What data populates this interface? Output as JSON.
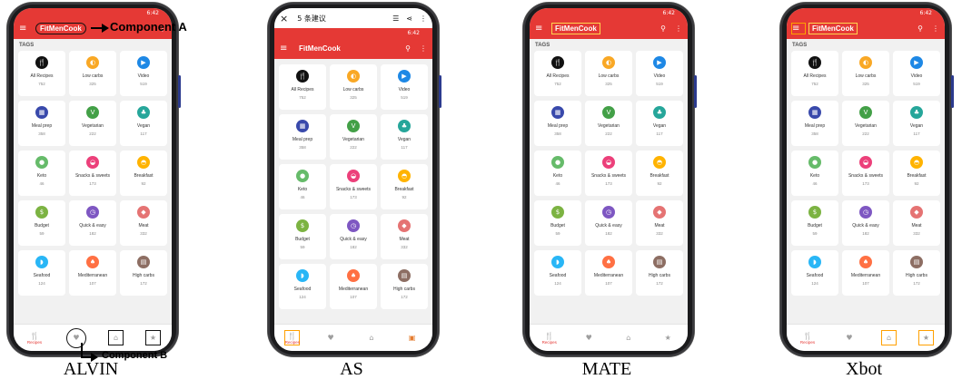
{
  "app": {
    "title": "FitMenCook",
    "status_time": "6:42",
    "tags_label": "TAGS",
    "menu_icon": "hamburger-icon",
    "search_icon": "search-icon",
    "more_icon": "more-vert-icon"
  },
  "tags": [
    {
      "label": "All Recipes",
      "count": "752",
      "icon": "utensils-icon",
      "color": "#111111",
      "glyph": "🍴"
    },
    {
      "label": "Low carbs",
      "count": "325",
      "icon": "bread-icon",
      "color": "#f9a825",
      "glyph": "◐"
    },
    {
      "label": "Video",
      "count": "519",
      "icon": "play-icon",
      "color": "#1e88e5",
      "glyph": "▶"
    },
    {
      "label": "Meal prep",
      "count": "358",
      "icon": "calendar-icon",
      "color": "#3949ab",
      "glyph": "▦"
    },
    {
      "label": "Vegetarian",
      "count": "222",
      "icon": "leaf-icon",
      "color": "#43a047",
      "glyph": "V"
    },
    {
      "label": "Vegan",
      "count": "117",
      "icon": "sprout-icon",
      "color": "#26a69a",
      "glyph": "♣"
    },
    {
      "label": "Keto",
      "count": "46",
      "icon": "avocado-icon",
      "color": "#66bb6a",
      "glyph": "●"
    },
    {
      "label": "Snacks & sweets",
      "count": "173",
      "icon": "cupcake-icon",
      "color": "#ec407a",
      "glyph": "◒"
    },
    {
      "label": "Breakfast",
      "count": "92",
      "icon": "egg-icon",
      "color": "#ffb300",
      "glyph": "◓"
    },
    {
      "label": "Budget",
      "count": "59",
      "icon": "coin-icon",
      "color": "#7cb342",
      "glyph": "$"
    },
    {
      "label": "Quick & easy",
      "count": "182",
      "icon": "timer-icon",
      "color": "#7e57c2",
      "glyph": "◷"
    },
    {
      "label": "Meat",
      "count": "332",
      "icon": "steak-icon",
      "color": "#e57373",
      "glyph": "◆"
    },
    {
      "label": "Seafood",
      "count": "124",
      "icon": "fish-icon",
      "color": "#29b6f6",
      "glyph": "◗"
    },
    {
      "label": "Mediterranean",
      "count": "107",
      "icon": "olive-icon",
      "color": "#ff7043",
      "glyph": "♠"
    },
    {
      "label": "High carbs",
      "count": "172",
      "icon": "jar-icon",
      "color": "#8d6e63",
      "glyph": "▤"
    }
  ],
  "nav": {
    "recipes_label": "Recipes",
    "recipes_icon": "fork-knife-icon",
    "favorites_icon": "heart-icon",
    "basket_icon": "basket-icon",
    "star_icon": "star-icon"
  },
  "as_overlay": {
    "title": "5 条建议",
    "close_glyph": "×"
  },
  "panels": [
    "ALVIN",
    "AS",
    "MATE",
    "Xbot"
  ],
  "annotations": {
    "component_a": "Component A",
    "component_b": "Component B"
  }
}
